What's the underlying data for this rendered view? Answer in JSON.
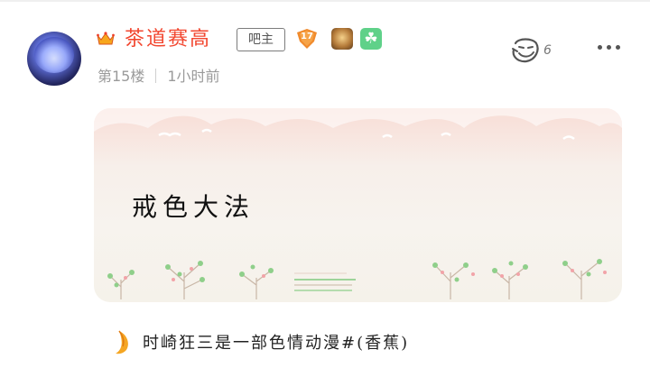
{
  "post": {
    "username": "茶道赛高",
    "owner_badge": "吧主",
    "level": "17",
    "floor": "第15楼",
    "time": "1小时前",
    "like_count": "6"
  },
  "card": {
    "text": "戒色大法"
  },
  "footer": {
    "text": "时崎狂三是一部色情动漫#(香蕉)"
  },
  "colors": {
    "username": "#f2462f",
    "level_badge": "#f08a2c",
    "clover_medal": "#5fd189"
  },
  "icons": [
    "avatar",
    "crown-icon",
    "level-badge-icon",
    "medal-icon",
    "clover-icon",
    "like-face-icon",
    "more-dots-icon",
    "banana-icon"
  ]
}
